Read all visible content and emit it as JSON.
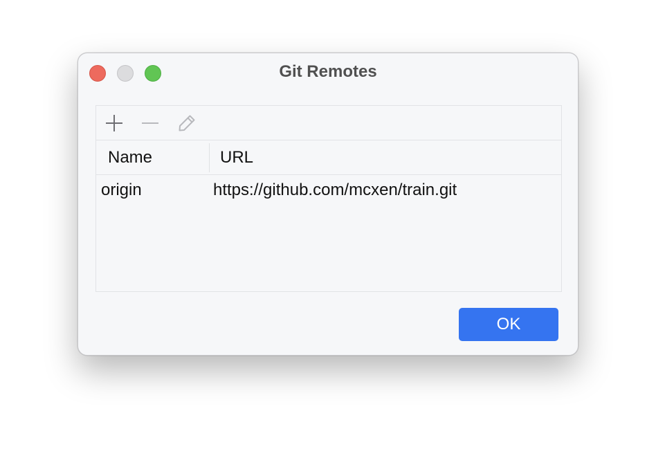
{
  "window": {
    "title": "Git Remotes"
  },
  "toolbar": {
    "add_icon": "plus-icon",
    "remove_icon": "minus-icon",
    "edit_icon": "pencil-icon"
  },
  "table": {
    "columns": [
      "Name",
      "URL"
    ],
    "rows": [
      {
        "name": "origin",
        "url": "https://github.com/mcxen/train.git"
      }
    ]
  },
  "buttons": {
    "ok_label": "OK"
  },
  "colors": {
    "accent": "#3574f0",
    "close": "#ed6a5e",
    "minimize": "#dcdcde",
    "maximize": "#61c554"
  }
}
